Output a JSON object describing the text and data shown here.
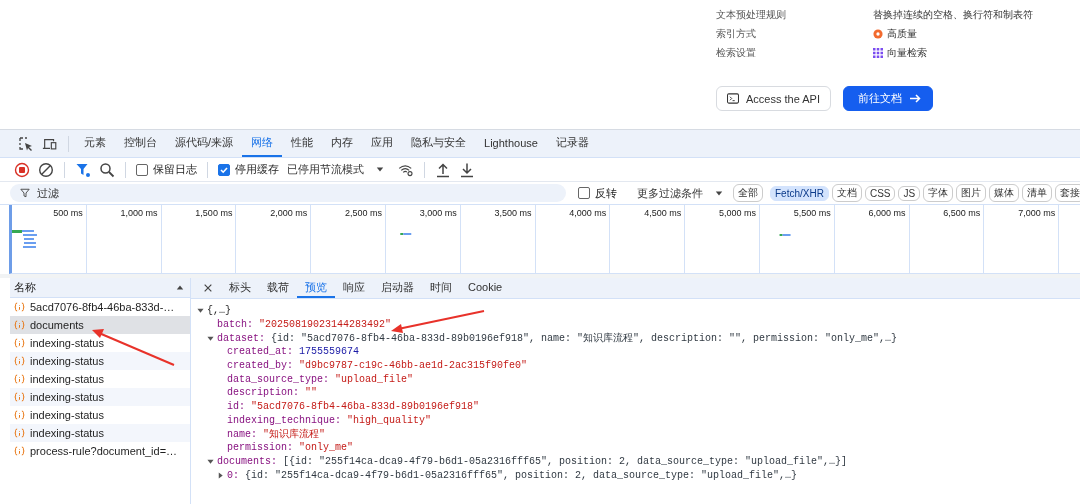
{
  "page": {
    "settings": [
      {
        "label": "文本预处理规则",
        "value": "替换掉连续的空格、换行符和制表符",
        "kind": "plain"
      },
      {
        "label": "索引方式",
        "value": "高质量",
        "kind": "quality"
      },
      {
        "label": "检索设置",
        "value": "向量检索",
        "kind": "vector"
      }
    ],
    "buttons": [
      {
        "label": "Access the API",
        "kind": "secondary"
      },
      {
        "label": "前往文档",
        "kind": "primary"
      }
    ]
  },
  "devtools": {
    "tabs": [
      {
        "label": "元素",
        "selected": false
      },
      {
        "label": "控制台",
        "selected": false
      },
      {
        "label": "源代码/来源",
        "selected": false
      },
      {
        "label": "网络",
        "selected": true
      },
      {
        "label": "性能",
        "selected": false
      },
      {
        "label": "内存",
        "selected": false
      },
      {
        "label": "应用",
        "selected": false
      },
      {
        "label": "隐私与安全",
        "selected": false
      },
      {
        "label": "Lighthouse",
        "selected": false
      },
      {
        "label": "记录器",
        "selected": false
      }
    ],
    "toolbar": {
      "preserve_log": {
        "label": "保留日志",
        "checked": false
      },
      "disable_cache": {
        "label": "停用缓存",
        "checked": true
      },
      "throttling": "已停用节流模式"
    },
    "filter": {
      "placeholder": "过滤",
      "invert": {
        "label": "反转",
        "checked": false
      },
      "more": "更多过滤条件",
      "types": [
        {
          "label": "全部",
          "selected": false
        },
        {
          "label": "Fetch/XHR",
          "selected": true
        },
        {
          "label": "文档",
          "selected": false
        },
        {
          "label": "CSS",
          "selected": false
        },
        {
          "label": "JS",
          "selected": false
        },
        {
          "label": "字体",
          "selected": false
        },
        {
          "label": "图片",
          "selected": false
        },
        {
          "label": "媒体",
          "selected": false
        },
        {
          "label": "清单",
          "selected": false
        },
        {
          "label": "套接",
          "selected": false
        }
      ]
    },
    "timeline": {
      "ticks": [
        "500 ms",
        "1,000 ms",
        "1,500 ms",
        "2,000 ms",
        "2,500 ms",
        "3,000 ms",
        "3,500 ms",
        "4,000 ms",
        "4,500 ms",
        "5,000 ms",
        "5,500 ms",
        "6,000 ms",
        "6,500 ms",
        "7,000 ms"
      ]
    },
    "requests": {
      "header": "名称",
      "items": [
        {
          "name": "5acd7076-8fb4-46ba-833d-…",
          "selected": false
        },
        {
          "name": "documents",
          "selected": true
        },
        {
          "name": "indexing-status",
          "selected": false
        },
        {
          "name": "indexing-status",
          "selected": false
        },
        {
          "name": "indexing-status",
          "selected": false
        },
        {
          "name": "indexing-status",
          "selected": false
        },
        {
          "name": "indexing-status",
          "selected": false
        },
        {
          "name": "indexing-status",
          "selected": false
        },
        {
          "name": "process-rule?document_id=…",
          "selected": false
        }
      ]
    },
    "detail_tabs": [
      {
        "label": "标头",
        "selected": false
      },
      {
        "label": "载荷",
        "selected": false
      },
      {
        "label": "预览",
        "selected": true
      },
      {
        "label": "响应",
        "selected": false
      },
      {
        "label": "启动器",
        "selected": false
      },
      {
        "label": "时间",
        "selected": false
      },
      {
        "label": "Cookie",
        "selected": false
      }
    ],
    "preview": {
      "root": {
        "value": "{,…}",
        "expanded": true,
        "children": [
          {
            "key": "batch:",
            "value": "\"20250819023144283492\"",
            "kind": "string"
          },
          {
            "key": "dataset:",
            "value": "{id: \"5acd7076-8fb4-46ba-833d-89b0196ef918\", name: \"知识库流程\", description: \"\", permission: \"only_me\",…}",
            "kind": "object",
            "expanded": true,
            "children": [
              {
                "key": "created_at:",
                "value": "1755559674",
                "kind": "number"
              },
              {
                "key": "created_by:",
                "value": "\"d9bc9787-c19c-46bb-ae1d-2ac315f90fe0\"",
                "kind": "string"
              },
              {
                "key": "data_source_type:",
                "value": "\"upload_file\"",
                "kind": "string"
              },
              {
                "key": "description:",
                "value": "\"\"",
                "kind": "string"
              },
              {
                "key": "id:",
                "value": "\"5acd7076-8fb4-46ba-833d-89b0196ef918\"",
                "kind": "string"
              },
              {
                "key": "indexing_technique:",
                "value": "\"high_quality\"",
                "kind": "string"
              },
              {
                "key": "name:",
                "value": "\"知识库流程\"",
                "kind": "string"
              },
              {
                "key": "permission:",
                "value": "\"only_me\"",
                "kind": "string"
              }
            ]
          },
          {
            "key": "documents:",
            "value": "[{id: \"255f14ca-dca9-4f79-b6d1-05a2316fff65\", position: 2, data_source_type: \"upload_file\",…}]",
            "kind": "object",
            "expanded": true,
            "children": [
              {
                "key": "0:",
                "value": "{id: \"255f14ca-dca9-4f79-b6d1-05a2316fff65\", position: 2, data_source_type: \"upload_file\",…}",
                "kind": "object",
                "expanded": false
              }
            ]
          }
        ]
      }
    }
  }
}
